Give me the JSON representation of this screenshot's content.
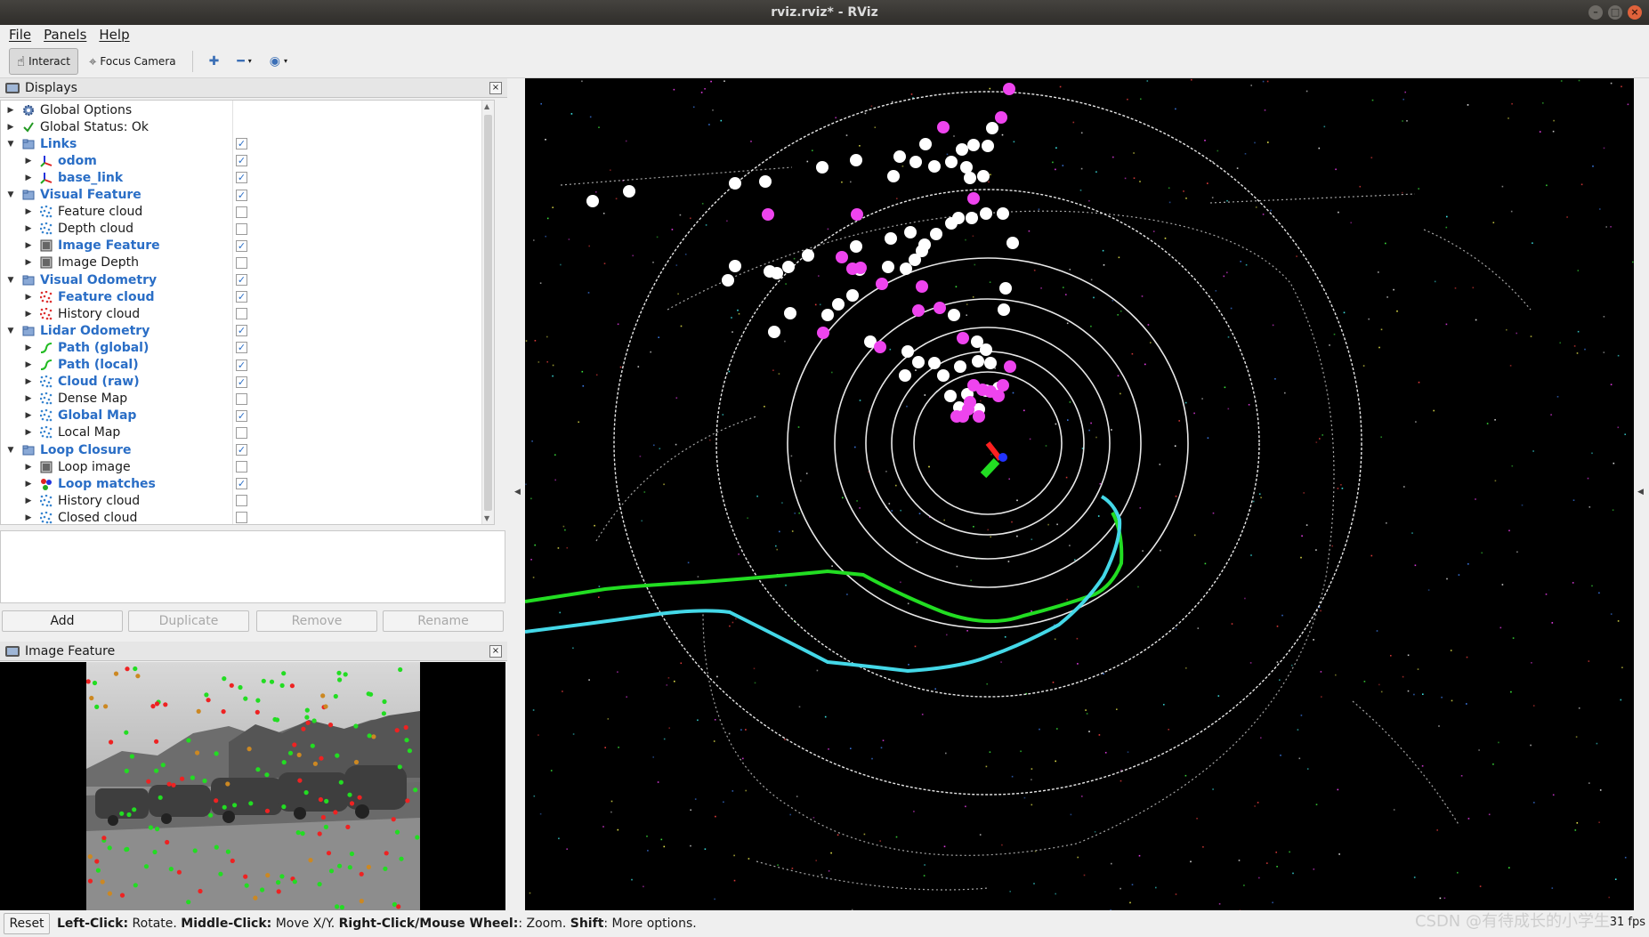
{
  "window": {
    "title": "rviz.rviz* - RViz"
  },
  "menu": {
    "file": "File",
    "panels": "Panels",
    "help": "Help"
  },
  "toolbar": {
    "interact": "Interact",
    "focus_camera": "Focus Camera"
  },
  "displays_panel": {
    "title": "Displays",
    "rows": [
      {
        "label": "Global Options",
        "indent": 0,
        "icon": "gear-icon",
        "expanded": false,
        "checkbox": null,
        "highlight": false
      },
      {
        "label": "Global Status: Ok",
        "indent": 0,
        "icon": "check-icon",
        "expanded": false,
        "checkbox": null,
        "highlight": false
      },
      {
        "label": "Links",
        "indent": 0,
        "icon": "folder-icon",
        "expanded": true,
        "checkbox": true,
        "highlight": true
      },
      {
        "label": "odom",
        "indent": 1,
        "icon": "axes-icon",
        "expanded": false,
        "checkbox": true,
        "highlight": true
      },
      {
        "label": "base_link",
        "indent": 1,
        "icon": "axes-icon",
        "expanded": false,
        "checkbox": true,
        "highlight": true
      },
      {
        "label": "Visual Feature",
        "indent": 0,
        "icon": "folder-icon",
        "expanded": true,
        "checkbox": true,
        "highlight": true
      },
      {
        "label": "Feature cloud",
        "indent": 1,
        "icon": "pointcloud-icon",
        "expanded": false,
        "checkbox": false,
        "highlight": false
      },
      {
        "label": "Depth cloud",
        "indent": 1,
        "icon": "pointcloud-icon",
        "expanded": false,
        "checkbox": false,
        "highlight": false
      },
      {
        "label": "Image Feature",
        "indent": 1,
        "icon": "image-icon",
        "expanded": false,
        "checkbox": true,
        "highlight": true
      },
      {
        "label": "Image Depth",
        "indent": 1,
        "icon": "image-icon",
        "expanded": false,
        "checkbox": false,
        "highlight": false
      },
      {
        "label": "Visual Odometry",
        "indent": 0,
        "icon": "folder-icon",
        "expanded": true,
        "checkbox": true,
        "highlight": true
      },
      {
        "label": "Feature cloud",
        "indent": 1,
        "icon": "pointcloud-red-icon",
        "expanded": false,
        "checkbox": true,
        "highlight": true
      },
      {
        "label": "History cloud",
        "indent": 1,
        "icon": "pointcloud-red-icon",
        "expanded": false,
        "checkbox": false,
        "highlight": false
      },
      {
        "label": "Lidar Odometry",
        "indent": 0,
        "icon": "folder-icon",
        "expanded": true,
        "checkbox": true,
        "highlight": true
      },
      {
        "label": "Path (global)",
        "indent": 1,
        "icon": "path-icon",
        "expanded": false,
        "checkbox": true,
        "highlight": true
      },
      {
        "label": "Path (local)",
        "indent": 1,
        "icon": "path-icon",
        "expanded": false,
        "checkbox": true,
        "highlight": true
      },
      {
        "label": "Cloud (raw)",
        "indent": 1,
        "icon": "pointcloud-icon",
        "expanded": false,
        "checkbox": true,
        "highlight": true
      },
      {
        "label": "Dense Map",
        "indent": 1,
        "icon": "pointcloud-icon",
        "expanded": false,
        "checkbox": false,
        "highlight": false
      },
      {
        "label": "Global Map",
        "indent": 1,
        "icon": "pointcloud-icon",
        "expanded": false,
        "checkbox": true,
        "highlight": true
      },
      {
        "label": "Local Map",
        "indent": 1,
        "icon": "pointcloud-icon",
        "expanded": false,
        "checkbox": false,
        "highlight": false
      },
      {
        "label": "Loop Closure",
        "indent": 0,
        "icon": "folder-icon",
        "expanded": true,
        "checkbox": true,
        "highlight": true
      },
      {
        "label": "Loop image",
        "indent": 1,
        "icon": "image-icon",
        "expanded": false,
        "checkbox": false,
        "highlight": false
      },
      {
        "label": "Loop matches",
        "indent": 1,
        "icon": "markers-icon",
        "expanded": false,
        "checkbox": true,
        "highlight": true
      },
      {
        "label": "History cloud",
        "indent": 1,
        "icon": "pointcloud-icon",
        "expanded": false,
        "checkbox": false,
        "highlight": false
      },
      {
        "label": "Closed cloud",
        "indent": 1,
        "icon": "pointcloud-icon",
        "expanded": false,
        "checkbox": false,
        "highlight": false
      }
    ],
    "buttons": {
      "add": "Add",
      "duplicate": "Duplicate",
      "remove": "Remove",
      "rename": "Rename"
    }
  },
  "image_panel": {
    "title": "Image Feature"
  },
  "status": {
    "reset": "Reset",
    "parts": [
      {
        "b": "Left-Click:",
        "t": " Rotate. "
      },
      {
        "b": "Middle-Click:",
        "t": " Move X/Y. "
      },
      {
        "b": "Right-Click/Mouse Wheel:",
        "t": ": Zoom. "
      },
      {
        "b": "Shift",
        "t": ": More options."
      }
    ],
    "fps": "31 fps"
  },
  "watermark": "CSDN @有待成长的小学生",
  "colors": {
    "path_global": "#22dd22",
    "path_local": "#44d8e8",
    "feature_white": "#ffffff",
    "feature_magenta": "#ee44ee",
    "highlight_text": "#2a6ec6"
  }
}
